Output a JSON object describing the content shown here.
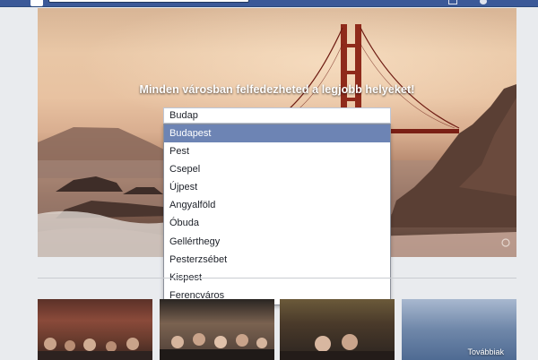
{
  "hero": {
    "headline": "Minden városban felfedezheted a legjobb helyeket!"
  },
  "search": {
    "value": "Budap"
  },
  "dropdown": {
    "options": [
      "Budapest",
      "Pest",
      "Csepel",
      "Újpest",
      "Angyalföld",
      "Óbuda",
      "Gellérthegy",
      "Pesterzsébet",
      "Kispest",
      "Ferencváros"
    ],
    "selected_index": 0
  },
  "thumbnails": {
    "more_label": "Továbbiak"
  },
  "colors": {
    "facebook_blue": "#3b5998",
    "highlight": "#6d84b4",
    "page_bg": "#e9ebee"
  }
}
